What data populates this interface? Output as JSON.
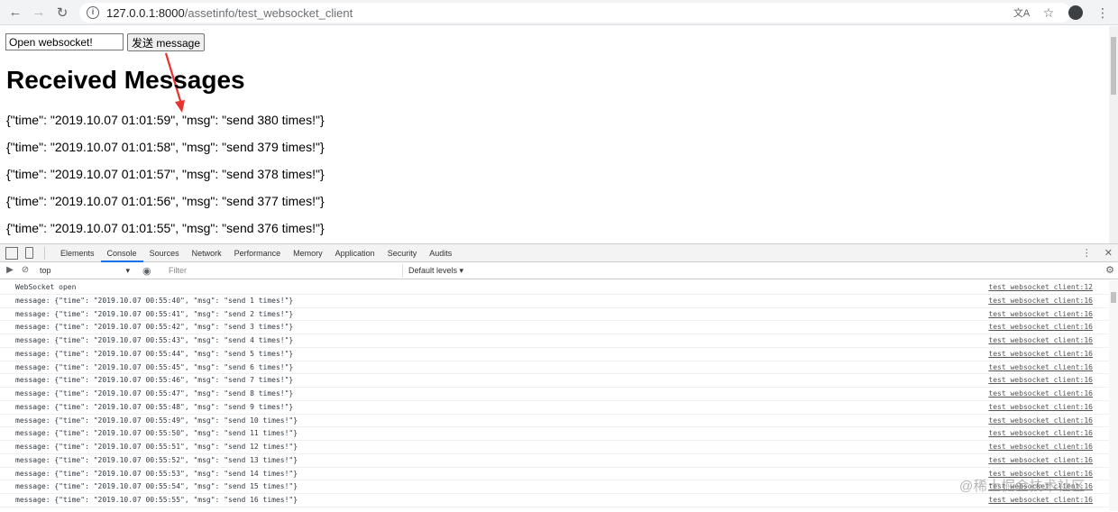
{
  "browser": {
    "url_host": "127.0.0.1:8000",
    "url_path": "/assetinfo/test_websocket_client"
  },
  "page": {
    "input_value": "Open websocket!",
    "send_button": "发送 message",
    "heading": "Received Messages",
    "messages": [
      "{\"time\": \"2019.10.07 01:01:59\", \"msg\": \"send 380 times!\"}",
      "{\"time\": \"2019.10.07 01:01:58\", \"msg\": \"send 379 times!\"}",
      "{\"time\": \"2019.10.07 01:01:57\", \"msg\": \"send 378 times!\"}",
      "{\"time\": \"2019.10.07 01:01:56\", \"msg\": \"send 377 times!\"}",
      "{\"time\": \"2019.10.07 01:01:55\", \"msg\": \"send 376 times!\"}"
    ]
  },
  "devtools": {
    "tabs": [
      "Elements",
      "Console",
      "Sources",
      "Network",
      "Performance",
      "Memory",
      "Application",
      "Security",
      "Audits"
    ],
    "active_tab": "Console",
    "context": "top",
    "filter_placeholder": "Filter",
    "levels": "Default levels",
    "logs": [
      {
        "text": "WebSocket open",
        "src": "test_websocket_client:12"
      },
      {
        "text": "message: {\"time\": \"2019.10.07 00:55:40\", \"msg\": \"send 1 times!\"}",
        "src": "test_websocket_client:16"
      },
      {
        "text": "message: {\"time\": \"2019.10.07 00:55:41\", \"msg\": \"send 2 times!\"}",
        "src": "test_websocket_client:16"
      },
      {
        "text": "message: {\"time\": \"2019.10.07 00:55:42\", \"msg\": \"send 3 times!\"}",
        "src": "test_websocket_client:16"
      },
      {
        "text": "message: {\"time\": \"2019.10.07 00:55:43\", \"msg\": \"send 4 times!\"}",
        "src": "test_websocket_client:16"
      },
      {
        "text": "message: {\"time\": \"2019.10.07 00:55:44\", \"msg\": \"send 5 times!\"}",
        "src": "test_websocket_client:16"
      },
      {
        "text": "message: {\"time\": \"2019.10.07 00:55:45\", \"msg\": \"send 6 times!\"}",
        "src": "test_websocket_client:16"
      },
      {
        "text": "message: {\"time\": \"2019.10.07 00:55:46\", \"msg\": \"send 7 times!\"}",
        "src": "test_websocket_client:16"
      },
      {
        "text": "message: {\"time\": \"2019.10.07 00:55:47\", \"msg\": \"send 8 times!\"}",
        "src": "test_websocket_client:16"
      },
      {
        "text": "message: {\"time\": \"2019.10.07 00:55:48\", \"msg\": \"send 9 times!\"}",
        "src": "test_websocket_client:16"
      },
      {
        "text": "message: {\"time\": \"2019.10.07 00:55:49\", \"msg\": \"send 10 times!\"}",
        "src": "test_websocket_client:16"
      },
      {
        "text": "message: {\"time\": \"2019.10.07 00:55:50\", \"msg\": \"send 11 times!\"}",
        "src": "test_websocket_client:16"
      },
      {
        "text": "message: {\"time\": \"2019.10.07 00:55:51\", \"msg\": \"send 12 times!\"}",
        "src": "test_websocket_client:16"
      },
      {
        "text": "message: {\"time\": \"2019.10.07 00:55:52\", \"msg\": \"send 13 times!\"}",
        "src": "test_websocket_client:16"
      },
      {
        "text": "message: {\"time\": \"2019.10.07 00:55:53\", \"msg\": \"send 14 times!\"}",
        "src": "test_websocket_client:16"
      },
      {
        "text": "message: {\"time\": \"2019.10.07 00:55:54\", \"msg\": \"send 15 times!\"}",
        "src": "test_websocket_client:16"
      },
      {
        "text": "message: {\"time\": \"2019.10.07 00:55:55\", \"msg\": \"send 16 times!\"}",
        "src": "test_websocket_client:16"
      }
    ]
  },
  "watermark": "@稀土掘金技术社区",
  "icons": {
    "back": "back-arrow-icon",
    "forward": "forward-arrow-icon",
    "reload": "reload-icon",
    "info": "info-icon",
    "translate": "translate-icon",
    "bookmark": "star-icon",
    "profile": "avatar-icon",
    "menu": "kebab-menu-icon"
  }
}
